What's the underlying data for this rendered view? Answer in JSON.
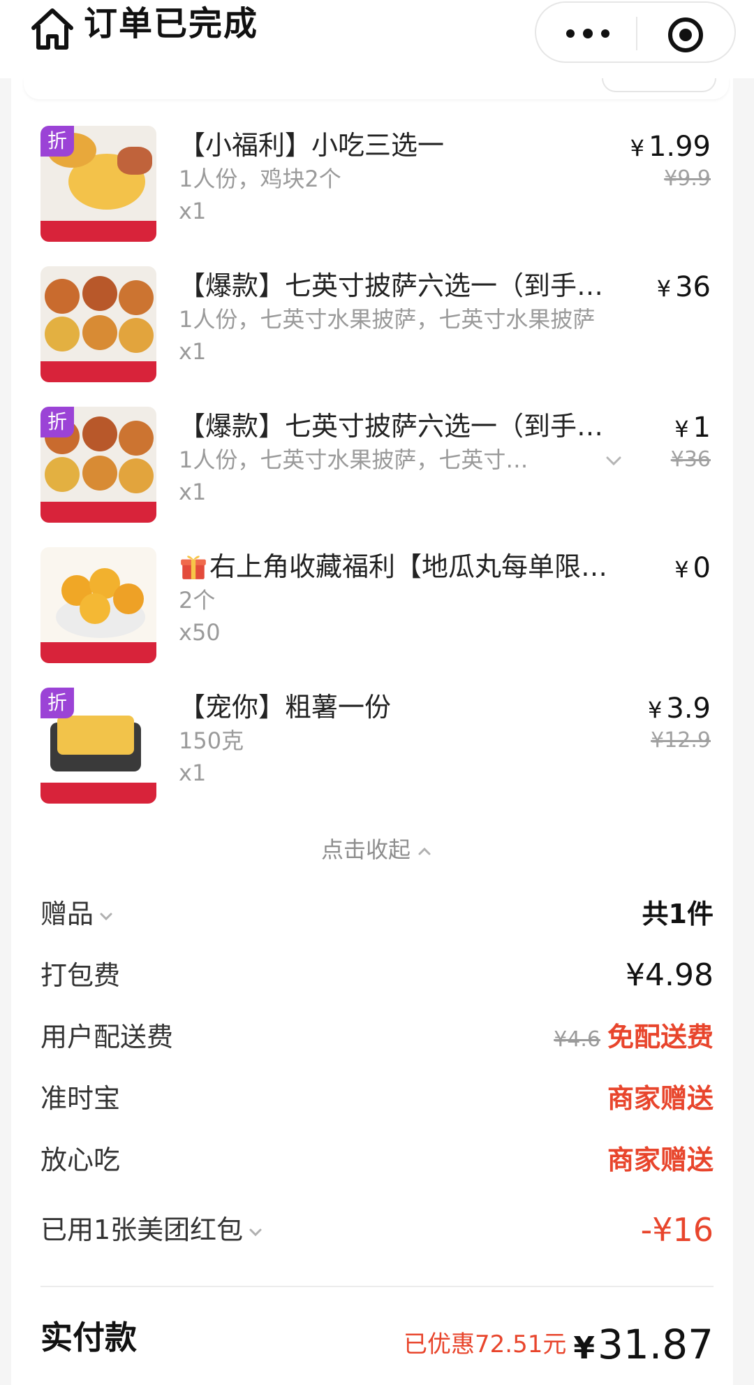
{
  "header": {
    "title": "订单已完成"
  },
  "items": [
    {
      "name": "【小福利】小吃三选一",
      "spec": "1人份，鸡块2个",
      "qty": "x1",
      "price": "1.99",
      "original_price": "¥9.9",
      "discount_badge": "折"
    },
    {
      "name": "【爆款】七英寸披萨六选一（到手…",
      "spec": "1人份，七英寸水果披萨，七英寸水果披萨",
      "qty": "x1",
      "price": "36",
      "original_price": "",
      "discount_badge": ""
    },
    {
      "name": "【爆款】七英寸披萨六选一（到手…",
      "spec": "1人份，七英寸水果披萨，七英寸…",
      "qty": "x1",
      "price": "1",
      "original_price": "¥36",
      "discount_badge": "折"
    },
    {
      "name": "右上角收藏福利【地瓜丸每单限…",
      "spec": "2个",
      "qty": "x50",
      "price": "0",
      "original_price": "",
      "discount_badge": "",
      "name_icon": "gift-icon"
    },
    {
      "name": "【宠你】粗薯一份",
      "spec": "150克",
      "qty": "x1",
      "price": "3.9",
      "original_price": "¥12.9",
      "discount_badge": "折"
    }
  ],
  "currency_symbol": "¥",
  "collapse_label": "点击收起",
  "fees": {
    "gift": {
      "label": "赠品",
      "value": "共1件"
    },
    "packing": {
      "label": "打包费",
      "value": "¥4.98"
    },
    "delivery": {
      "label": "用户配送费",
      "original": "¥4.6",
      "value": "免配送费"
    },
    "on_time": {
      "label": "准时宝",
      "value": "商家赠送"
    },
    "safe_eat": {
      "label": "放心吃",
      "value": "商家赠送"
    },
    "red_packet": {
      "label": "已用1张美团红包",
      "value": "-¥16"
    }
  },
  "total": {
    "label": "实付款",
    "saved": "已优惠72.51元",
    "value": "31.87"
  },
  "colors": {
    "accent_red": "#e8452c",
    "badge_purple": "#9b43d6",
    "thumb_band_red": "#d8233a"
  }
}
